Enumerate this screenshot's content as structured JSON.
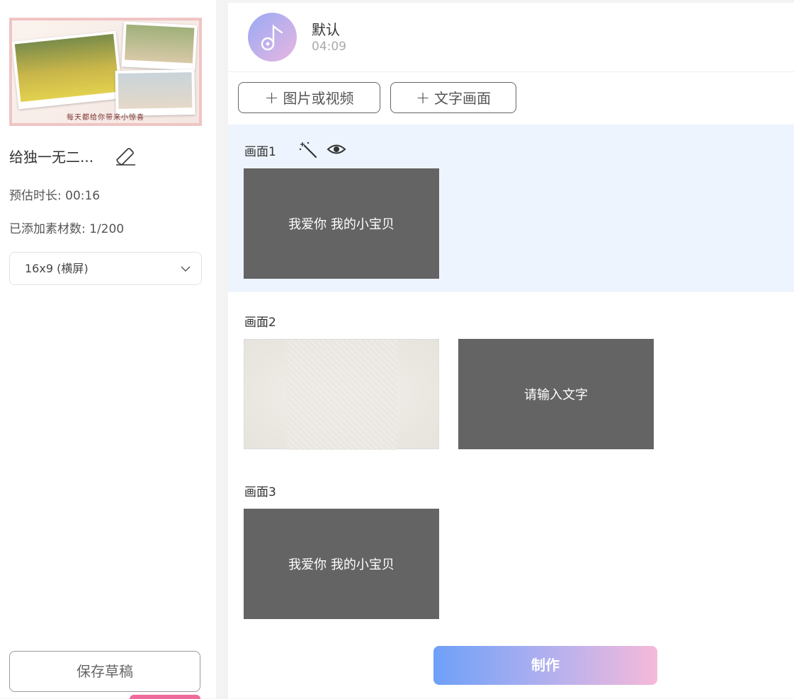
{
  "project": {
    "cover_caption": "每天都给你带来小惊喜",
    "title": "给独一无二...",
    "duration_label": "预估时长: 00:16",
    "materials_label": "已添加素材数: 1/200",
    "aspect_ratio": "16x9 (横屏)",
    "save_label": "保存草稿"
  },
  "music": {
    "name": "默认",
    "duration": "04:09"
  },
  "toolbar": {
    "add_media_label": "图片或视频",
    "add_text_label": "文字画面"
  },
  "scenes": [
    {
      "label": "画面1",
      "tiles": [
        {
          "type": "text",
          "text": "我爱你 我的小宝贝"
        }
      ]
    },
    {
      "label": "画面2",
      "tiles": [
        {
          "type": "image",
          "text": ""
        },
        {
          "type": "text",
          "text": "请输入文字"
        }
      ]
    },
    {
      "label": "画面3",
      "tiles": [
        {
          "type": "text",
          "text": "我爱你 我的小宝贝"
        }
      ]
    }
  ],
  "make_label": "制作",
  "colors": {
    "accent_start": "#6ea0f8",
    "accent_end": "#f6b9d9",
    "tile_bg": "#646464",
    "selected_bg": "#eef4fd"
  },
  "icons": [
    "edit-icon",
    "chevron-down-icon",
    "music-note-icon",
    "plus-icon",
    "magic-wand-icon",
    "eye-icon"
  ]
}
